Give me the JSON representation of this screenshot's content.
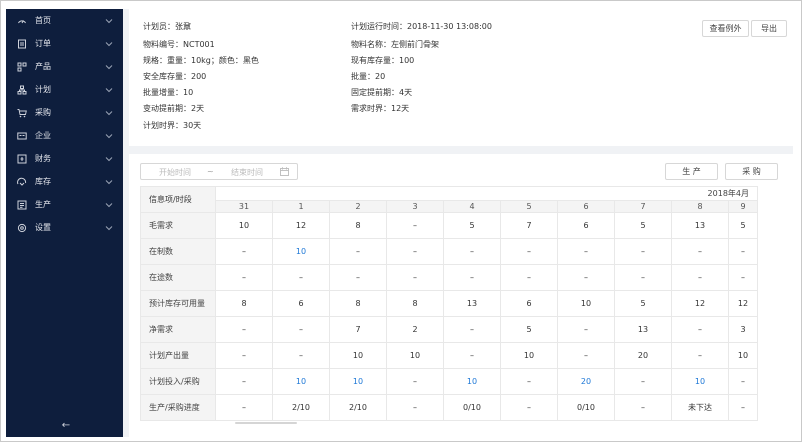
{
  "sidebar": {
    "items": [
      {
        "label": "首页",
        "icon": "home-icon"
      },
      {
        "label": "订单",
        "icon": "order-icon"
      },
      {
        "label": "产品",
        "icon": "product-icon"
      },
      {
        "label": "计划",
        "icon": "plan-icon"
      },
      {
        "label": "采购",
        "icon": "cart-icon"
      },
      {
        "label": "企业",
        "icon": "enterprise-icon"
      },
      {
        "label": "财务",
        "icon": "finance-icon"
      },
      {
        "label": "库存",
        "icon": "inventory-icon"
      },
      {
        "label": "生产",
        "icon": "production-icon"
      },
      {
        "label": "设置",
        "icon": "settings-icon"
      }
    ],
    "back_icon": "←"
  },
  "info": {
    "planner": "计划员：张鼐",
    "material_no": "物料编号：NCT001",
    "spec_prefix": "规格：",
    "spec_weight": "重量：10kg；",
    "spec_color": "颜色：黑色",
    "safety_stock": "安全库存量：200",
    "batch_increment": "批量增量：10",
    "variable_lead": "变动提前期：2天",
    "plan_horizon": "计划时界：30天",
    "run_time": "计划运行时间：2018-11-30  13:08:00",
    "material_name": "物料名称：左侧前门骨架",
    "current_stock": "现有库存量：100",
    "batch": "批量：20",
    "fixed_lead": "固定提前期：4天",
    "demand_horizon": "需求时界：12天"
  },
  "toolbar": {
    "view_exceptions": "查看例外",
    "export": "导出",
    "produce": "生 产",
    "purchase": "采 购"
  },
  "date_range": {
    "start_placeholder": "开始时间",
    "separator": "~",
    "end_placeholder": "结束时间"
  },
  "table": {
    "header_label": "信息项/时段",
    "month": "2018年4月",
    "days": [
      "31",
      "1",
      "2",
      "3",
      "4",
      "5",
      "6",
      "7",
      "8",
      "9"
    ],
    "rows": [
      {
        "label": "毛需求",
        "cells": [
          "10",
          "12",
          "8",
          "–",
          "5",
          "7",
          "6",
          "5",
          "13",
          "5"
        ],
        "blue": []
      },
      {
        "label": "在制数",
        "cells": [
          "–",
          "10",
          "–",
          "–",
          "–",
          "–",
          "–",
          "–",
          "–",
          "–"
        ],
        "blue": [
          1
        ]
      },
      {
        "label": "在途数",
        "cells": [
          "–",
          "–",
          "–",
          "–",
          "–",
          "–",
          "–",
          "–",
          "–",
          "–"
        ],
        "blue": []
      },
      {
        "label": "预计库存可用量",
        "cells": [
          "8",
          "6",
          "8",
          "8",
          "13",
          "6",
          "10",
          "5",
          "12",
          "12"
        ],
        "blue": []
      },
      {
        "label": "净需求",
        "cells": [
          "–",
          "–",
          "7",
          "2",
          "–",
          "5",
          "–",
          "13",
          "–",
          "3"
        ],
        "blue": []
      },
      {
        "label": "计划产出量",
        "cells": [
          "–",
          "–",
          "10",
          "10",
          "–",
          "10",
          "–",
          "20",
          "–",
          "10"
        ],
        "blue": []
      },
      {
        "label": "计划投入/采购",
        "cells": [
          "–",
          "10",
          "10",
          "–",
          "10",
          "–",
          "20",
          "–",
          "10",
          "–"
        ],
        "blue": [
          1,
          2,
          4,
          6,
          8
        ]
      },
      {
        "label": "生产/采购进度",
        "cells": [
          "–",
          "2/10",
          "2/10",
          "–",
          "0/10",
          "–",
          "0/10",
          "–",
          "未下达",
          "–"
        ],
        "blue": []
      }
    ]
  }
}
